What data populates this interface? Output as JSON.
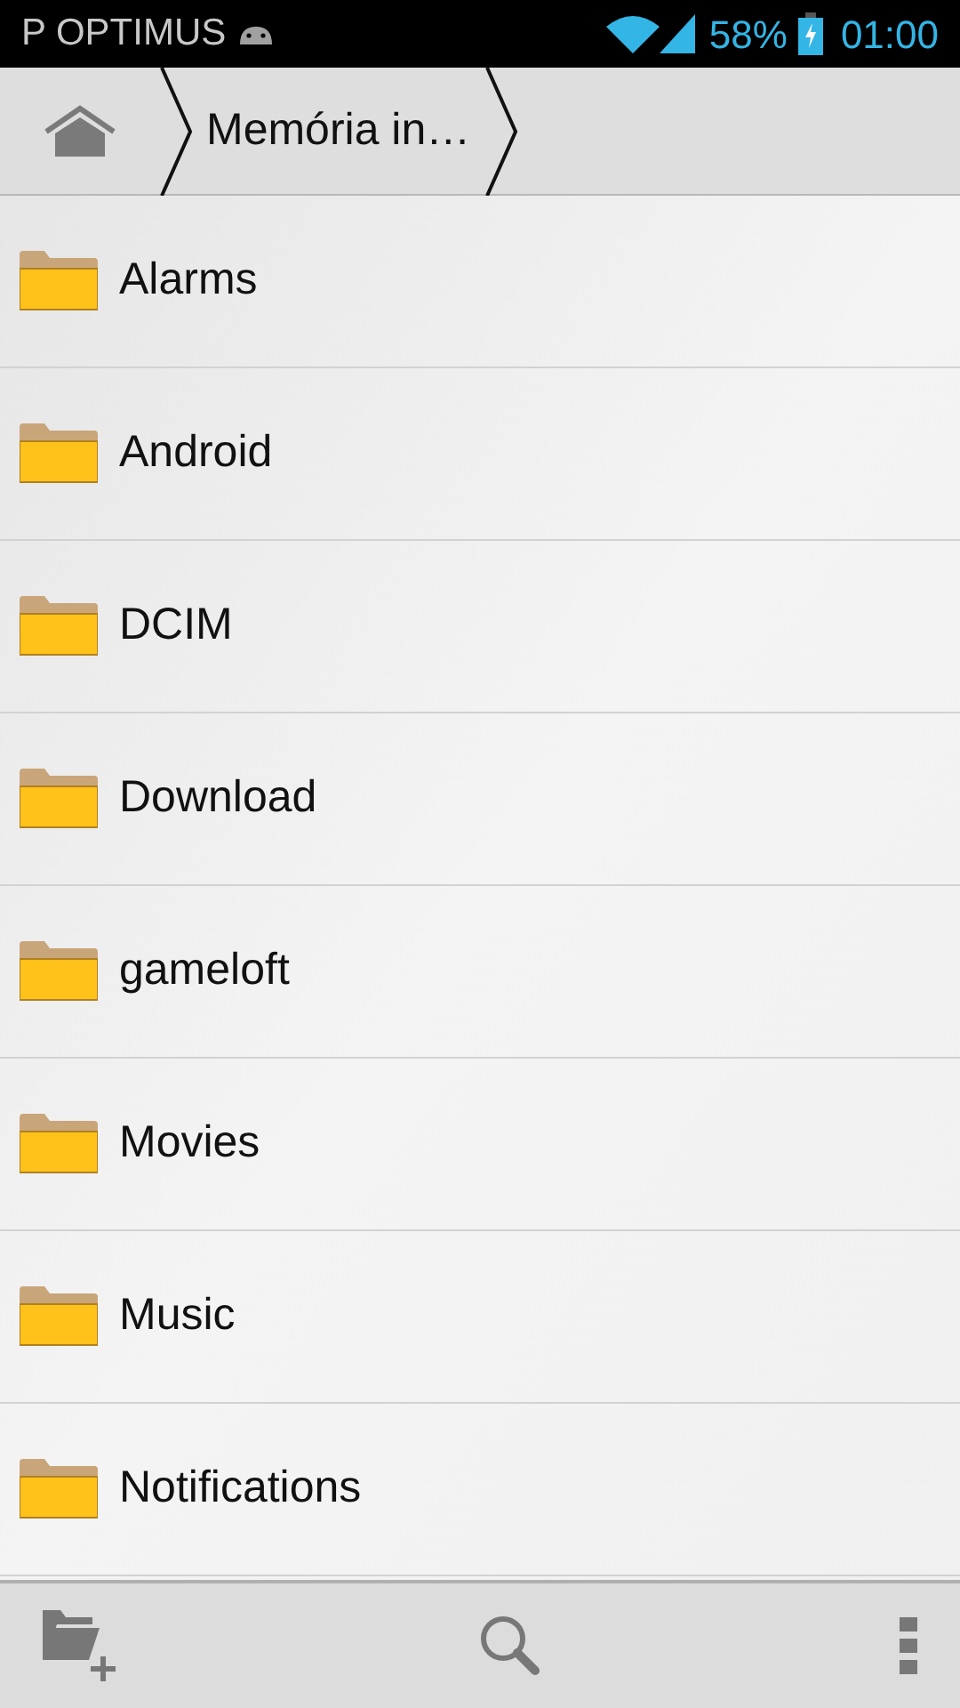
{
  "status_bar": {
    "carrier": "P OPTIMUS",
    "battery": "58%",
    "time": "01:00"
  },
  "breadcrumb": {
    "current": "Memória in…"
  },
  "folders": [
    {
      "name": "Alarms"
    },
    {
      "name": "Android"
    },
    {
      "name": "DCIM"
    },
    {
      "name": "Download"
    },
    {
      "name": "gameloft"
    },
    {
      "name": "Movies"
    },
    {
      "name": "Music"
    },
    {
      "name": "Notifications"
    }
  ]
}
